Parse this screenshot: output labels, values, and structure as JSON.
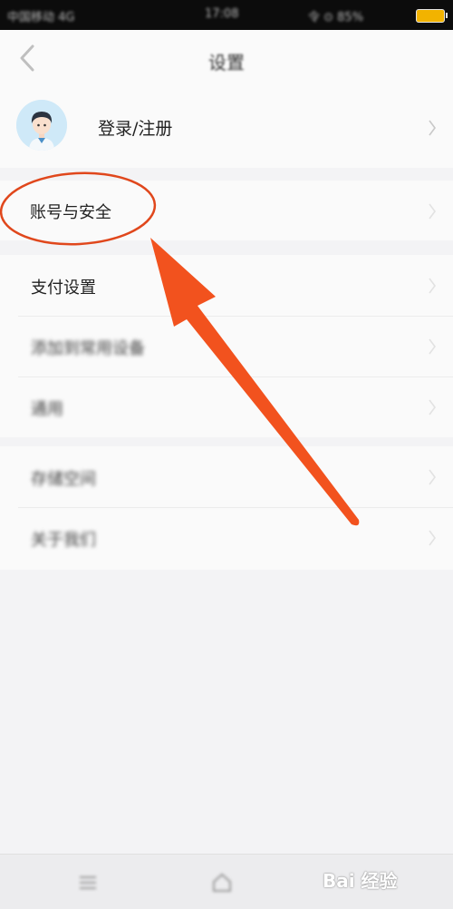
{
  "status_bar": {
    "carrier": "中国移动 4G",
    "time": "17:08",
    "right_info": "令 ⊙ 85%",
    "battery_level": 0.85,
    "battery_color": "#f2b300"
  },
  "navbar": {
    "back_icon": "chevron-left-icon",
    "title": "设置"
  },
  "profile": {
    "label": "登录/注册",
    "avatar_icon": "user-avatar"
  },
  "sections": {
    "account": {
      "label": "账号与安全"
    },
    "group2": [
      {
        "label": "支付设置"
      },
      {
        "label": "添加到常用设备"
      },
      {
        "label": "通用"
      }
    ],
    "group3": [
      {
        "label": "存储空间"
      },
      {
        "label": "关于我们"
      }
    ]
  },
  "annotation": {
    "circle_color": "#e0471c",
    "arrow_color": "#f2521e"
  },
  "tabbar": {
    "icons": [
      "menu-icon",
      "home-icon"
    ]
  },
  "watermark": "Bai 经验"
}
